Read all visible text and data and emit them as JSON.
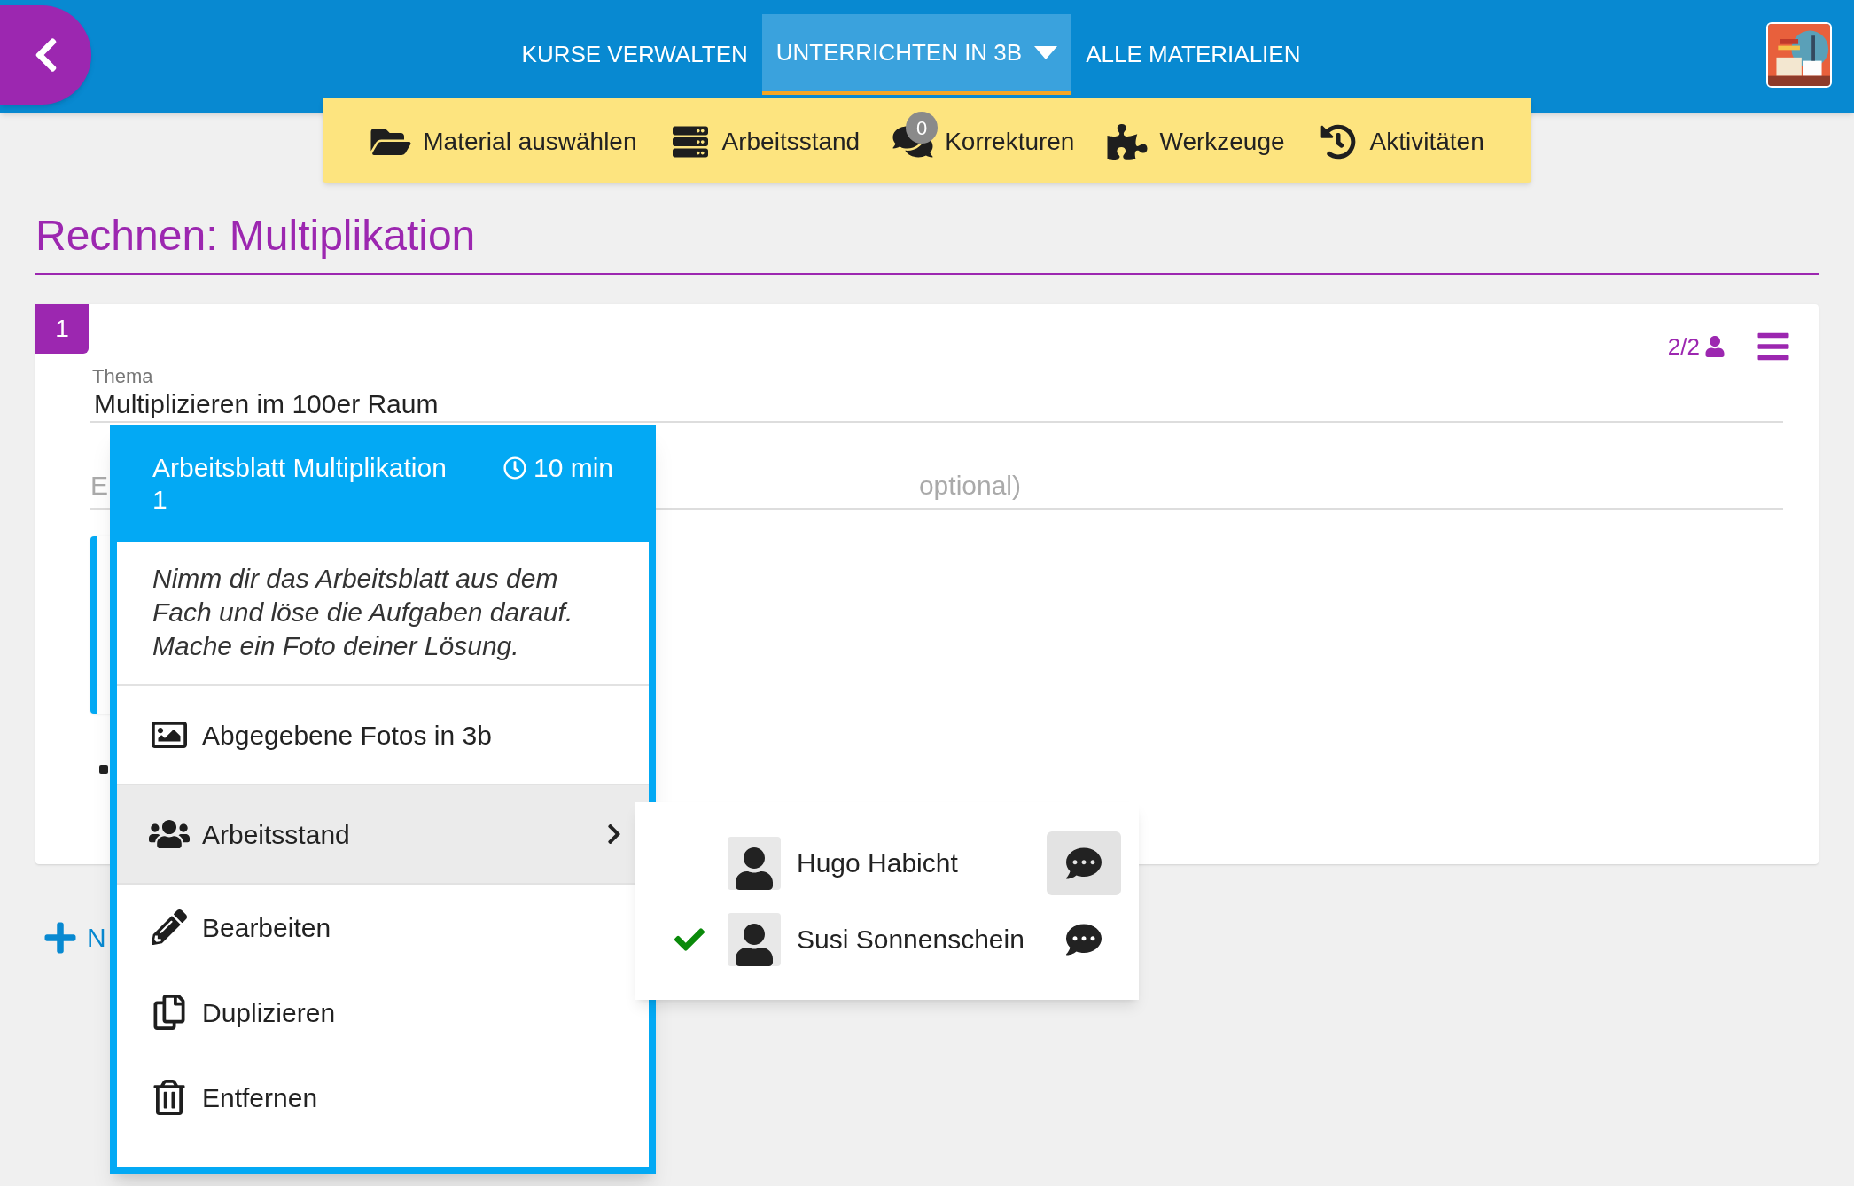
{
  "nav": {
    "tabs": [
      {
        "label": "KURSE VERWALTEN",
        "selected": false,
        "dropdown": false
      },
      {
        "label": "UNTERRICHTEN IN 3B",
        "selected": true,
        "dropdown": true
      },
      {
        "label": "ALLE MATERIALIEN",
        "selected": false,
        "dropdown": false
      }
    ]
  },
  "toolbar": [
    {
      "label": "Material auswählen",
      "kind": "folder"
    },
    {
      "label": "Arbeitsstand",
      "kind": "list"
    },
    {
      "label": "Korrekturen",
      "kind": "comments",
      "badge": "0"
    },
    {
      "label": "Werkzeuge",
      "kind": "puzzle"
    },
    {
      "label": "Aktivitäten",
      "kind": "history"
    }
  ],
  "page_title": "Rechnen: Multiplikation",
  "lesson": {
    "number": "1",
    "participants": "2/2",
    "topic_label": "Thema",
    "topic_value": "Multiplizieren im 100er Raum",
    "description_left": "E",
    "description_right": "optional)"
  },
  "add_link": "N",
  "popup": {
    "title": "Arbeitsblatt Multiplikation 1",
    "duration": "10 min",
    "instruction": "Nimm dir das Arbeitsblatt aus dem Fach und löse die Aufgaben darauf. Mache ein Foto deiner Lösung.",
    "items": [
      {
        "label": "Abgegebene Fotos in 3b",
        "kind": "photos",
        "selected": false,
        "submenu": false
      },
      {
        "label": "Arbeitsstand",
        "kind": "users",
        "selected": true,
        "submenu": true
      },
      {
        "label": "Bearbeiten",
        "kind": "edit",
        "selected": false,
        "submenu": false
      },
      {
        "label": "Duplizieren",
        "kind": "copy",
        "selected": false,
        "submenu": false
      },
      {
        "label": "Entfernen",
        "kind": "trash",
        "selected": false,
        "submenu": false
      }
    ]
  },
  "submenu": {
    "students": [
      {
        "name": "Hugo Habicht",
        "done": false,
        "chat_selected": true
      },
      {
        "name": "Susi Sonnenschein",
        "done": true,
        "chat_selected": false
      }
    ]
  }
}
